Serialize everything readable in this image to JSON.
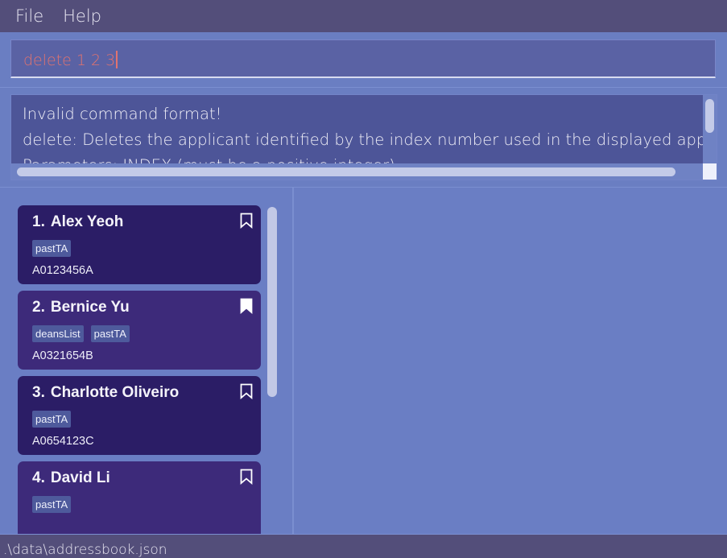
{
  "menu": {
    "file": "File",
    "help": "Help"
  },
  "command": {
    "value": "delete 1 2 3"
  },
  "result": {
    "lines": [
      "Invalid command format!",
      "delete: Deletes the applicant identified by the index number used in the displayed applicant list.",
      "Parameters: INDEX (must be a positive integer)"
    ]
  },
  "applicants": [
    {
      "index": "1.",
      "name": "Alex Yeoh",
      "tags": [
        "pastTA"
      ],
      "id": "A0123456A",
      "bookmarked": false
    },
    {
      "index": "2.",
      "name": "Bernice Yu",
      "tags": [
        "deansList",
        "pastTA"
      ],
      "id": "A0321654B",
      "bookmarked": true
    },
    {
      "index": "3.",
      "name": "Charlotte Oliveiro",
      "tags": [
        "pastTA"
      ],
      "id": "A0654123C",
      "bookmarked": false
    },
    {
      "index": "4.",
      "name": "David Li",
      "tags": [
        "pastTA"
      ],
      "id": "",
      "bookmarked": false
    }
  ],
  "status": {
    "path": ".\\data\\addressbook.json"
  },
  "colors": {
    "command_error": "#e2736e",
    "card_dark": "#2b1d66",
    "card_light": "#3d2a7a"
  }
}
